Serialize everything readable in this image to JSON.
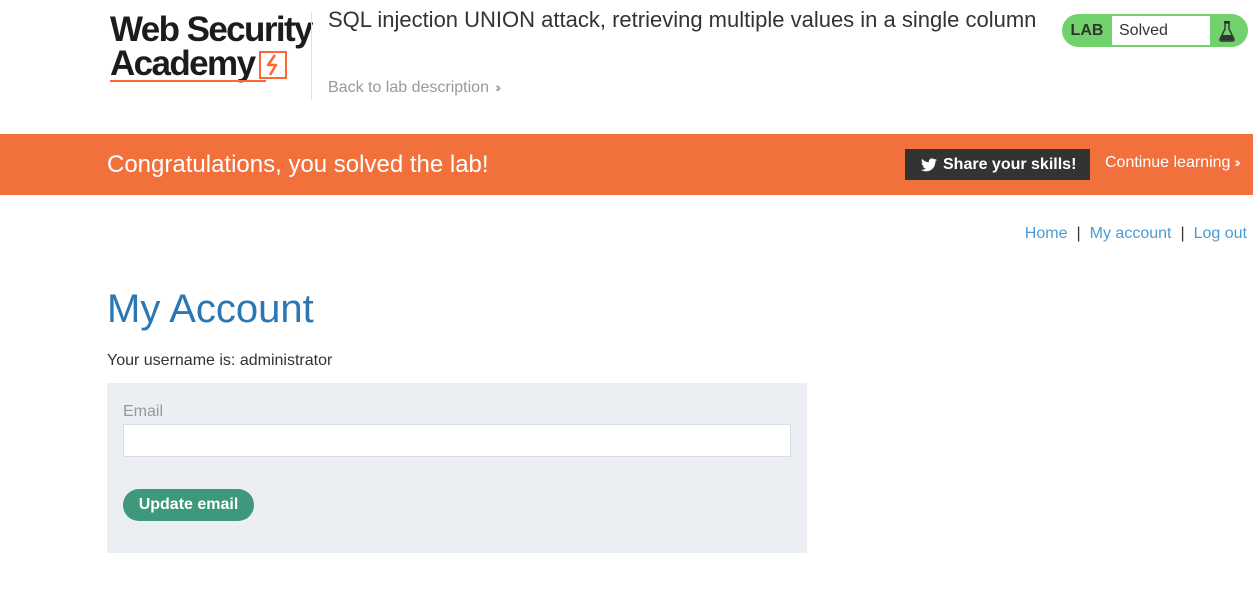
{
  "header": {
    "logo_line1": "Web Security",
    "logo_line2": "Academy",
    "lab_title": "SQL injection UNION attack, retrieving multiple values in a single column",
    "back_link": "Back to lab description",
    "lab_status": {
      "tag": "LAB",
      "state": "Solved",
      "icon": "flask-icon"
    }
  },
  "banner": {
    "message": "Congratulations, you solved the lab!",
    "share_label": "Share your skills!",
    "share_icon": "twitter-icon",
    "continue_label": "Continue learning"
  },
  "nav": {
    "home": "Home",
    "separator": "|",
    "my_account": "My account",
    "log_out": "Log out"
  },
  "main": {
    "title": "My Account",
    "username_text": "Your username is: administrator",
    "email_label": "Email",
    "email_value": "",
    "update_button": "Update email"
  },
  "colors": {
    "banner": "#f2703c",
    "status_green": "#70d16d",
    "link_blue": "#4a9bd6",
    "title_blue": "#2a77b4",
    "button_green": "#3d987c",
    "logo_accent": "#ff6633"
  }
}
